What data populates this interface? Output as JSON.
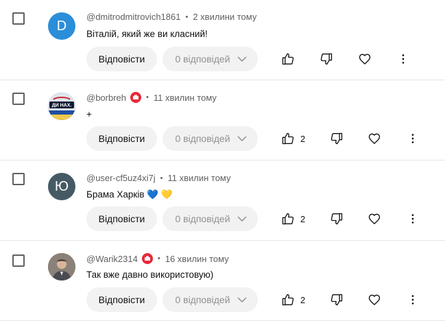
{
  "actions": {
    "reply_label": "Відповісти"
  },
  "comments": [
    {
      "author": "@dmitrodmitrovich1861",
      "time": "2 хвилини тому",
      "text": "Віталій, який же ви класний!",
      "avatar_letter": "D",
      "avatar_color": "#2b8ed9",
      "has_member_badge": false,
      "replies_label": "0 відповідей",
      "likes": ""
    },
    {
      "author": "@borbreh",
      "time": "11 хвилин тому",
      "text": "+",
      "avatar_letter": "",
      "avatar_color": "#1f2d4a",
      "has_member_badge": true,
      "replies_label": "0 відповідей",
      "likes": "2"
    },
    {
      "author": "@user-cf5uz4xi7j",
      "time": "11 хвилин тому",
      "text": "Брама Харків 💙 💛",
      "avatar_letter": "Ю",
      "avatar_color": "#455a64",
      "has_member_badge": false,
      "replies_label": "0 відповідей",
      "likes": "2"
    },
    {
      "author": "@Warik2314",
      "time": "16 хвилин тому",
      "text": "Так вже давно використовую)",
      "avatar_letter": "",
      "avatar_color": "#6b6258",
      "has_member_badge": true,
      "replies_label": "0 відповідей",
      "likes": "2"
    }
  ],
  "badge_text": "ДИ НАХ..."
}
